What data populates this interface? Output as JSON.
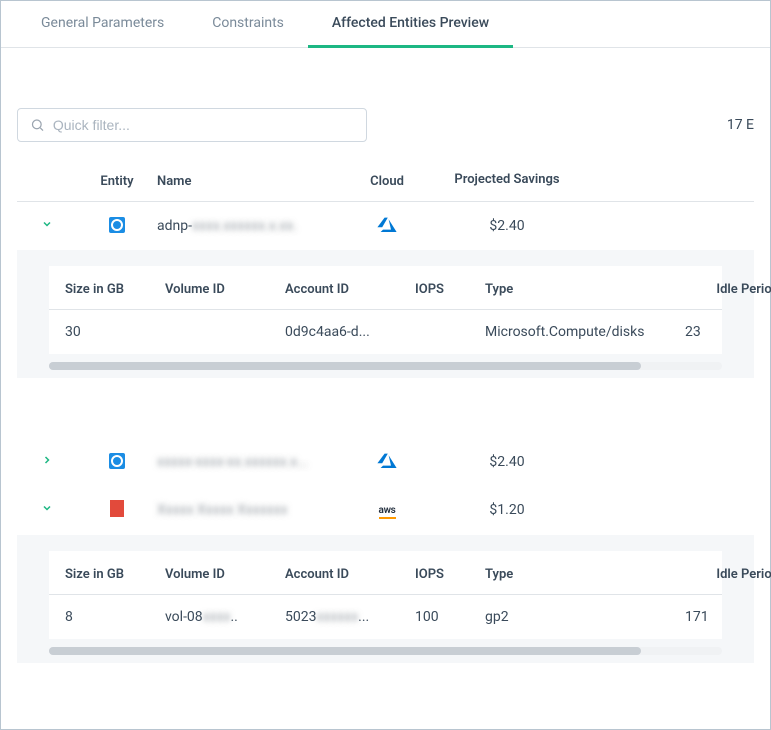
{
  "tabs": {
    "general": "General Parameters",
    "constraints": "Constraints",
    "preview": "Affected Entities Preview"
  },
  "search": {
    "placeholder": "Quick filter..."
  },
  "count_text": "17 E",
  "columns": {
    "entity": "Entity",
    "name": "Name",
    "cloud": "Cloud",
    "savings": "Projected Savings"
  },
  "detail_columns": {
    "size": "Size in GB",
    "volume": "Volume ID",
    "account": "Account ID",
    "iops": "IOPS",
    "type": "Type",
    "idle": "Idle Period"
  },
  "rows": [
    {
      "expand_state": "down",
      "entity_kind": "disk",
      "name_prefix": "adnp-",
      "name_rest": "xxxx.xxxxxx.x.xx.",
      "cloud": "azure",
      "savings": "$2.40",
      "detail": {
        "size": "30",
        "volume": "",
        "account": "0d9c4aa6-d...",
        "iops": "",
        "type": "Microsoft.Compute/disks",
        "idle": "23"
      }
    },
    {
      "expand_state": "right",
      "entity_kind": "disk",
      "name_prefix": "",
      "name_rest": "xxxxx-xxxx-xx.xxxxxx.x...",
      "cloud": "azure",
      "savings": "$2.40"
    },
    {
      "expand_state": "down",
      "entity_kind": "box",
      "name_prefix": "",
      "name_rest": "Xxxxx Xxxxx Xxxxxxx",
      "cloud": "aws",
      "savings": "$1.20",
      "detail": {
        "size": "8",
        "volume": "vol-08xxxxx..",
        "account": "5023xxxxxxx...",
        "iops": "100",
        "type": "gp2",
        "idle": "171"
      }
    }
  ]
}
